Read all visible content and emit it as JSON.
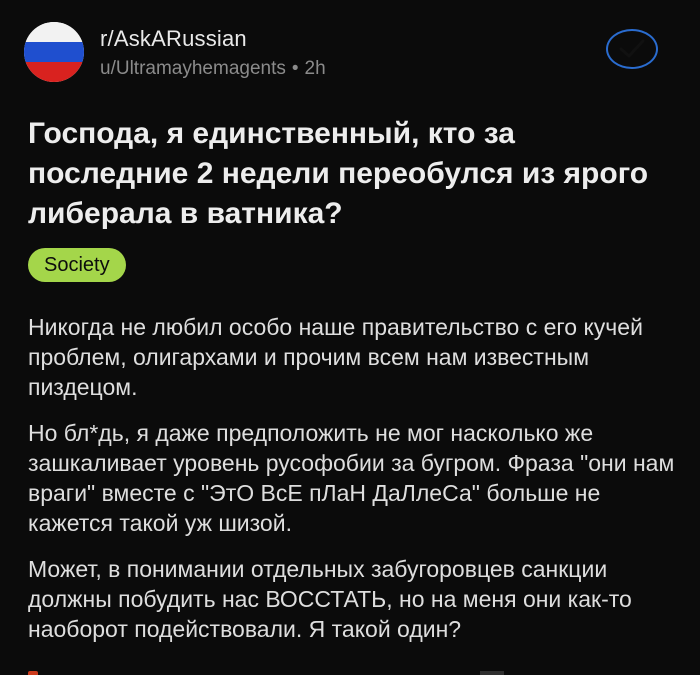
{
  "post": {
    "subreddit": "r/AskARussian",
    "author": "u/Ultramayhemagents",
    "separator": "•",
    "age": "2h",
    "title": "Господа, я единственный, кто за последние 2 недели переобулся из ярого либерала в ватника?",
    "flair": "Society",
    "paragraphs": [
      "Никогда не любил особо наше правительство с его кучей проблем, олигархами и прочим всем нам известным пиздецом.",
      "Но бл*дь, я даже предположить не мог насколько же зашкаливает уровень русофобии за бугром. Фраза \"они нам враги\" вместе с \"ЭтО ВсЕ пЛаН ДаЛлеСа\" больше не кажется такой уж шизой.",
      "Может, в понимании отдельных забугоровцев санкции должны побудить нас ВОССТАТЬ, но на меня они как-то наоборот подействовали. Я такой один?"
    ]
  },
  "icons": {
    "avatar": "russia-flag-icon",
    "action": "check-circle-icon"
  },
  "colors": {
    "background": "#0b0b0b",
    "flair_bg": "#a4d64a",
    "action_blue": "#2a6ccf"
  }
}
